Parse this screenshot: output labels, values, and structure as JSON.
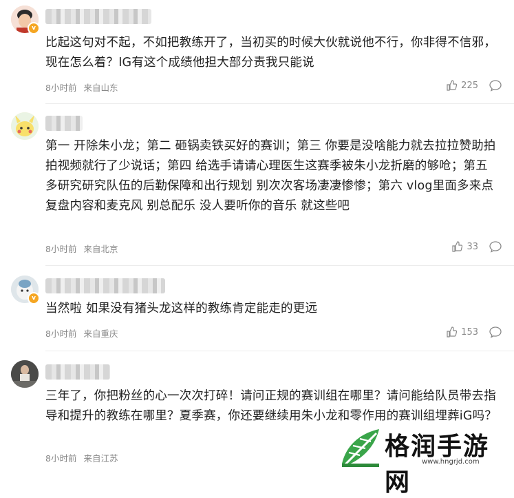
{
  "comments": [
    {
      "text": "比起这句对不起，不如把教练开了，当初买的时候大伙就说他不行，你非得不信邪，现在怎么着？IG有这个成绩他担大部分责我只能说",
      "time": "8小时前",
      "source": "来自山东",
      "likes": "225",
      "verified_badge": "v"
    },
    {
      "text": "第一 开除朱小龙；第二 砸锅卖铁买好的赛训；第三 你要是没啥能力就去拉拉赞助拍拍视频就行了少说话；第四 给选手请请心理医生这赛季被朱小龙折磨的够呛；第五 多研究研究队伍的后勤保障和出行规划 别次次客场凄凄惨惨；第六 vlog里面多来点复盘内容和麦克风 别总配乐 没人要听你的音乐 就这些吧",
      "time": "8小时前",
      "source": "来自北京",
      "likes": "33"
    },
    {
      "text": "当然啦 如果没有猪头龙这样的教练肯定能走的更远",
      "time": "8小时前",
      "source": "来自重庆",
      "likes": "153"
    },
    {
      "text": "三年了，你把粉丝的心一次次打碎！请问正规的赛训组在哪里？请问能给队员带去指导和提升的教练在哪里？夏季赛，你还要继续用朱小龙和零作用的赛训组埋葬iG吗？",
      "time": "8小时前",
      "source": "来自江苏",
      "likes": ""
    }
  ],
  "watermark": {
    "title": "格润手游网",
    "url": "www.hngrjd.com"
  },
  "colors": {
    "meta_text": "#888888",
    "badge": "#f5a623",
    "watermark_green": "#3aa54a"
  },
  "icons": [
    "thumb-up-icon",
    "comment-bubble-icon",
    "verified-badge-icon",
    "leaf-logo-icon"
  ]
}
